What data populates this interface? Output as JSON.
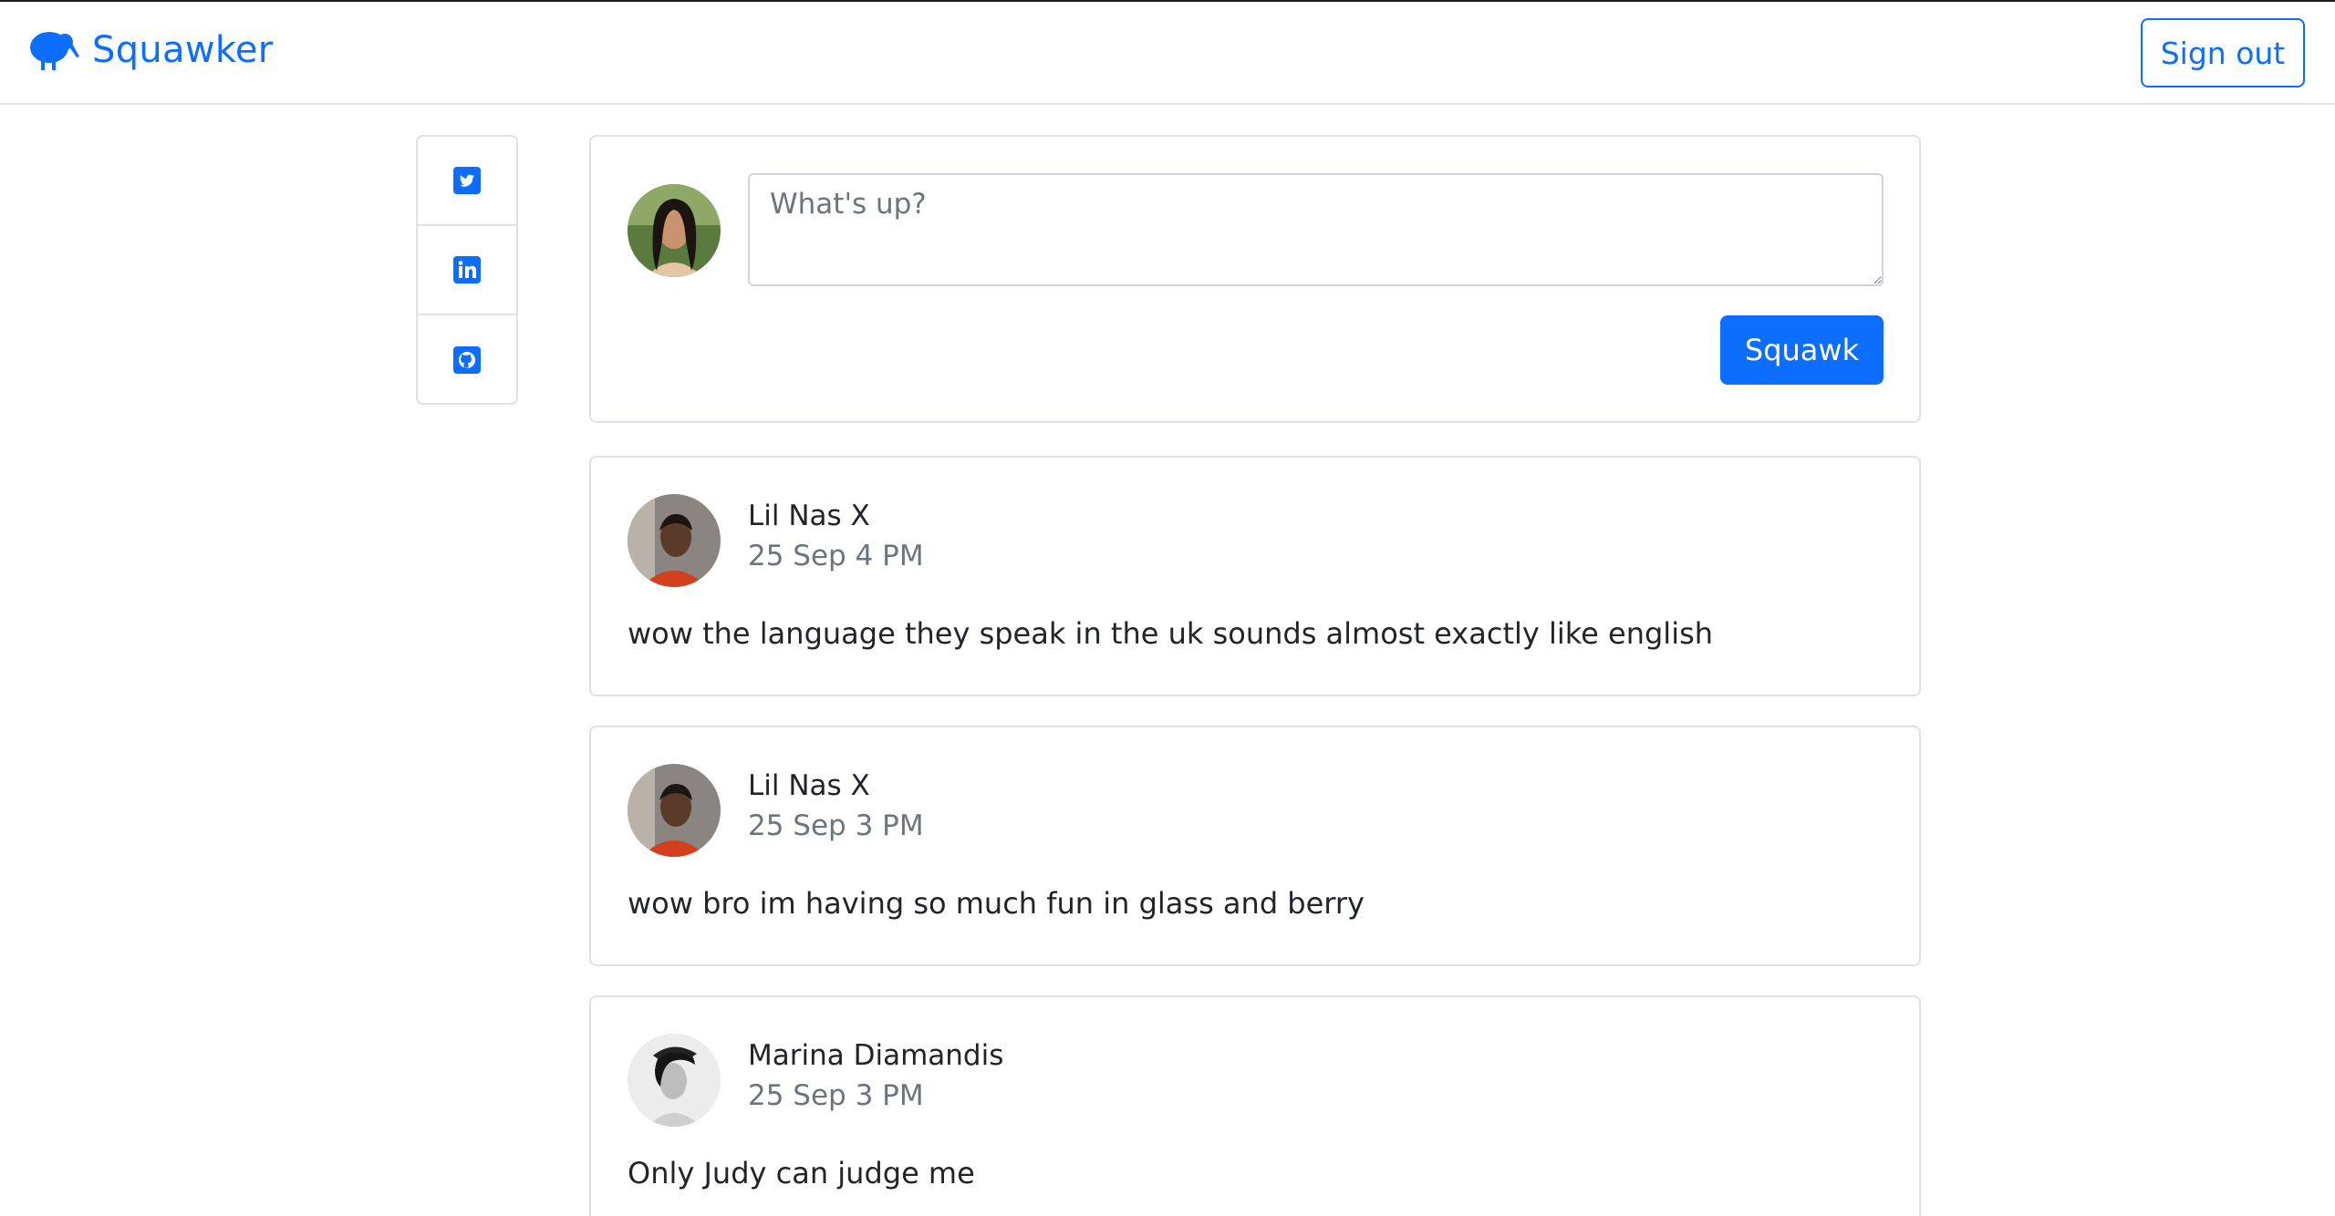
{
  "app": {
    "name": "Squawker",
    "brand_color": "#0d6efd",
    "logo_icon": "kiwi-bird-icon"
  },
  "header": {
    "sign_out_label": "Sign out"
  },
  "social_links": [
    {
      "name": "twitter",
      "icon": "twitter-icon"
    },
    {
      "name": "linkedin",
      "icon": "linkedin-icon"
    },
    {
      "name": "github",
      "icon": "github-icon"
    }
  ],
  "compose": {
    "placeholder": "What's up?",
    "value": "",
    "submit_label": "Squawk"
  },
  "posts": [
    {
      "author": "Lil Nas X",
      "time": "25 Sep 4 PM",
      "text": "wow the language they speak in the uk sounds almost exactly like english"
    },
    {
      "author": "Lil Nas X",
      "time": "25 Sep 3 PM",
      "text": "wow bro im having so much fun in glass and berry"
    },
    {
      "author": "Marina Diamandis",
      "time": "25 Sep 3 PM",
      "text": "Only Judy can judge me"
    }
  ]
}
